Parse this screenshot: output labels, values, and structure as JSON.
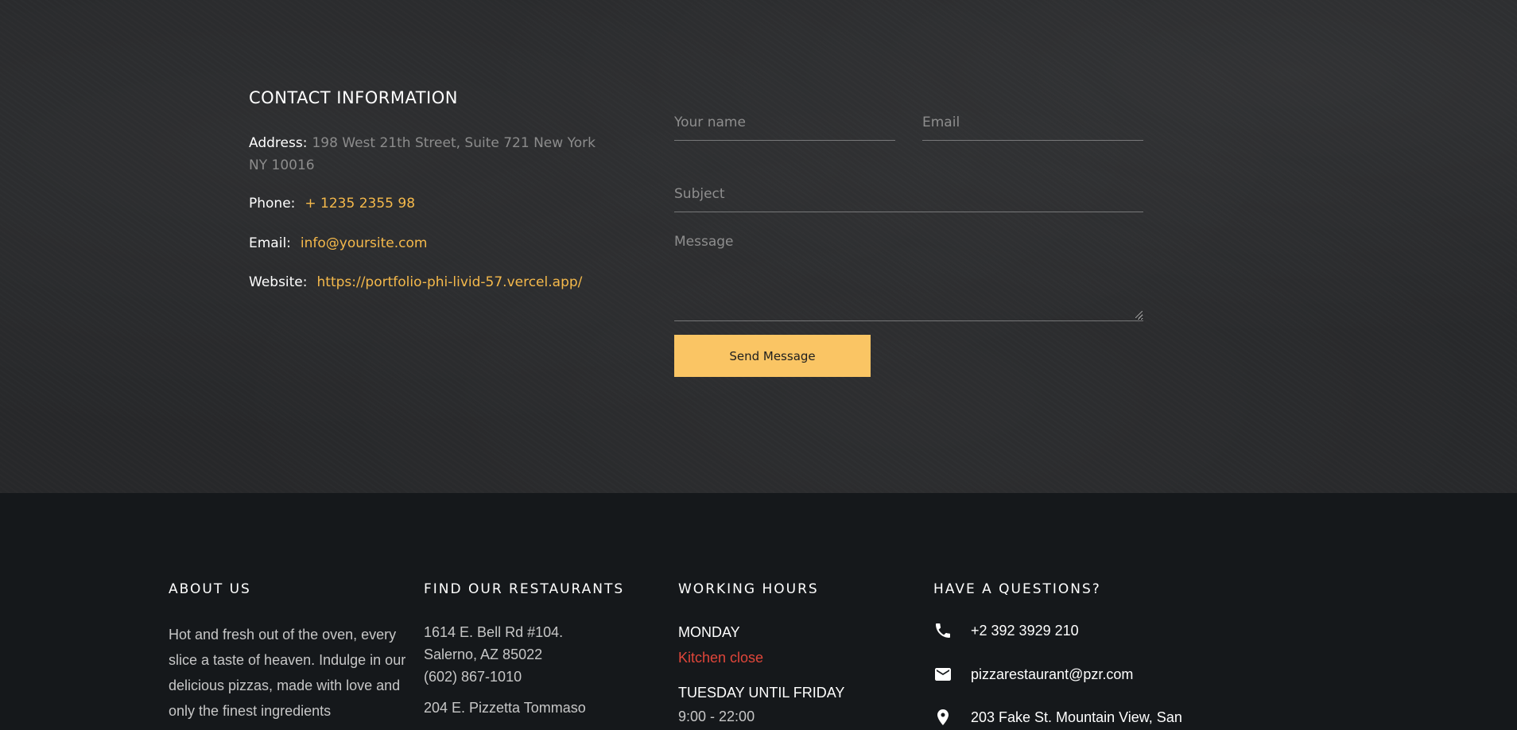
{
  "contact": {
    "title": "CONTACT INFORMATION",
    "address_label": "Address:",
    "address_line1": "198 West 21th Street, Suite 721 New York",
    "address_line2": "NY 10016",
    "phone_label": "Phone:",
    "phone_value": "+ 1235 2355 98",
    "email_label": "Email:",
    "email_value": "info@yoursite.com",
    "website_label": "Website:",
    "website_value": "https://portfolio-phi-livid-57.vercel.app/"
  },
  "form": {
    "name_placeholder": "Your name",
    "email_placeholder": "Email",
    "subject_placeholder": "Subject",
    "message_placeholder": "Message",
    "send_label": "Send Message"
  },
  "footer": {
    "about": {
      "title": "ABOUT US",
      "lines": [
        "Hot and fresh out of the oven, every",
        "slice a taste of heaven. Indulge in our",
        "delicious pizzas, made with love and",
        "only the finest ingredients"
      ]
    },
    "restaurants": {
      "title": "FIND OUR RESTAURANTS",
      "lines": [
        "1614 E. Bell Rd #104.",
        "Salerno, AZ 85022",
        "(602) 867-1010",
        "204 E. Pizzetta Tommaso"
      ]
    },
    "hours": {
      "title": "WORKING HOURS",
      "day1": "MONDAY",
      "day1_status": "Kitchen close",
      "day2": "TUESDAY UNTIL FRIDAY",
      "day2_hours": "9:00 - 22:00"
    },
    "questions": {
      "title": "HAVE A QUESTIONS?",
      "phone": "+2 392 3929 210",
      "email": "pizzarestaurant@pzr.com",
      "address": "203 Fake St. Mountain View, San"
    }
  },
  "colors": {
    "accent": "#fac564",
    "link": "#f5b94b",
    "alert": "#e0463a"
  }
}
